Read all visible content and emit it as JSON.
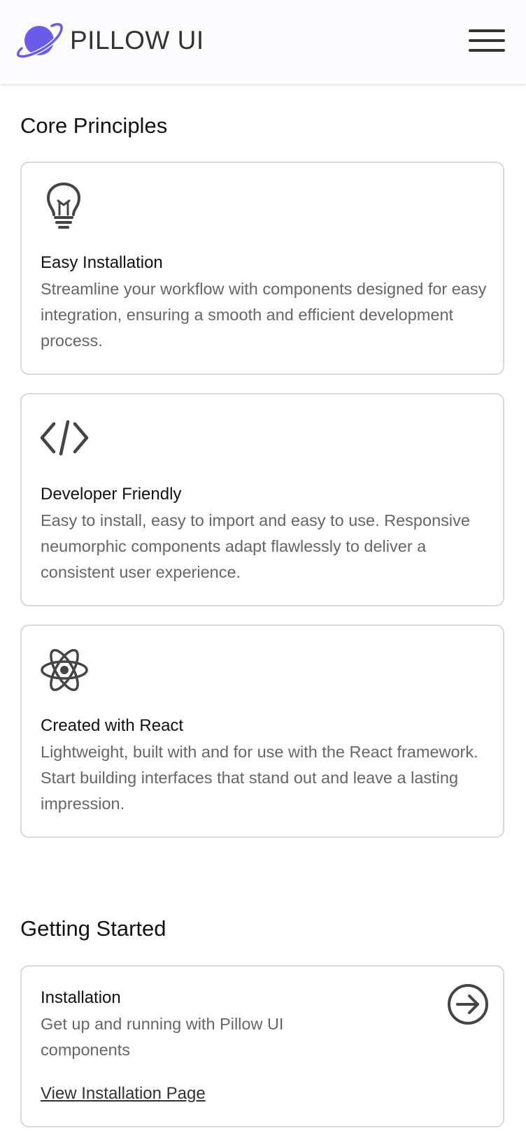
{
  "header": {
    "brand": "PILLOW UI",
    "logo_icon": "planet-icon",
    "menu_icon": "hamburger-menu-icon"
  },
  "core_principles": {
    "title": "Core Principles",
    "cards": [
      {
        "icon": "lightbulb-icon",
        "title": "Easy Installation",
        "description": "Streamline your workflow with components designed for easy integration, ensuring a smooth and efficient development process."
      },
      {
        "icon": "code-icon",
        "title": "Developer Friendly",
        "description": "Easy to install, easy to import and easy to use. Responsive neumorphic components adapt flawlessly to deliver a consistent user experience."
      },
      {
        "icon": "react-atom-icon",
        "title": "Created with React",
        "description": "Lightweight, built with and for use with the React framework. Start building interfaces that stand out and leave a lasting impression."
      }
    ]
  },
  "getting_started": {
    "title": "Getting Started",
    "cards": [
      {
        "icon": "arrow-circle-right-icon",
        "title": "Installation",
        "description": "Get up and running with Pillow UI components",
        "link": "View Installation Page"
      }
    ]
  },
  "colors": {
    "accent": "#6b5ce7",
    "text_dark": "#111111",
    "text_muted": "#666666",
    "border": "#d9d9d9",
    "header_bg": "#fbfbfd"
  }
}
